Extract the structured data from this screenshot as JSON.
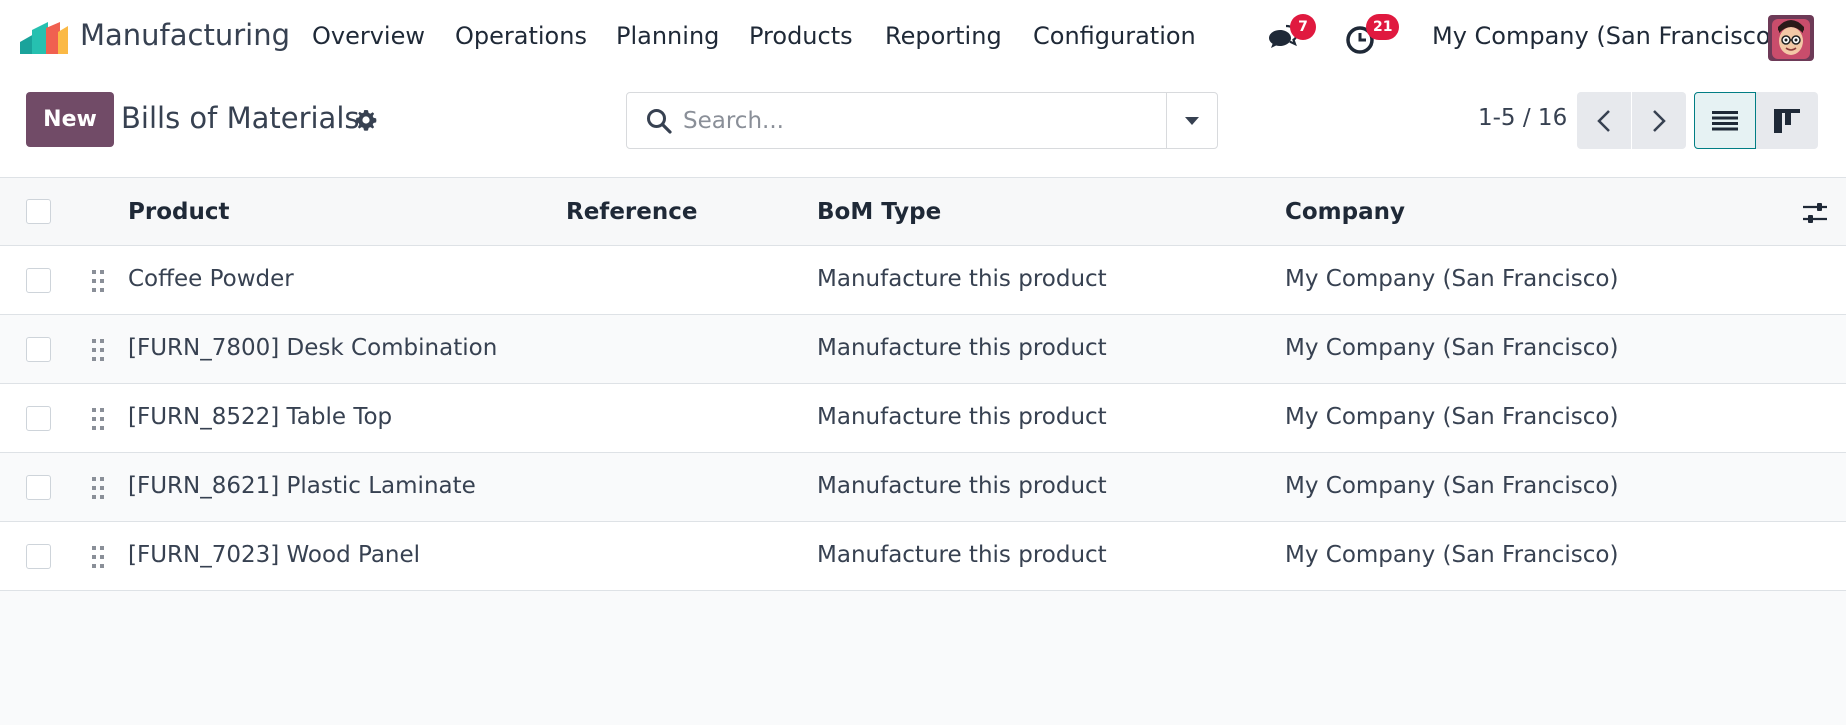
{
  "navbar": {
    "app_name": "Manufacturing",
    "menu": [
      "Overview",
      "Operations",
      "Planning",
      "Products",
      "Reporting",
      "Configuration"
    ],
    "messages_count": "7",
    "activities_count": "21",
    "company": "My Company (San Francisco)",
    "icons": {
      "logo": "manufacturing-app-logo",
      "messages": "chat-icon",
      "activities": "clock-icon",
      "avatar": "user-avatar"
    },
    "colors": {
      "badge": "#e0193f"
    }
  },
  "control_panel": {
    "new_label": "New",
    "title": "Bills of Materials",
    "settings_icon": "gear-icon",
    "search_placeholder": "Search...",
    "search_value": "",
    "pager": "1-5 / 16",
    "views": [
      "list-view-icon",
      "kanban-view-icon"
    ],
    "colors": {
      "primary": "#714b67",
      "active_view": "#017e84"
    }
  },
  "table": {
    "columns": [
      "Product",
      "Reference",
      "BoM Type",
      "Company"
    ],
    "rows": [
      {
        "product": "Coffee Powder",
        "reference": "",
        "bom_type": "Manufacture this product",
        "company": "My Company (San Francisco)"
      },
      {
        "product": "[FURN_7800] Desk Combination",
        "reference": "",
        "bom_type": "Manufacture this product",
        "company": "My Company (San Francisco)"
      },
      {
        "product": "[FURN_8522] Table Top",
        "reference": "",
        "bom_type": "Manufacture this product",
        "company": "My Company (San Francisco)"
      },
      {
        "product": "[FURN_8621] Plastic Laminate",
        "reference": "",
        "bom_type": "Manufacture this product",
        "company": "My Company (San Francisco)"
      },
      {
        "product": "[FURN_7023] Wood Panel",
        "reference": "",
        "bom_type": "Manufacture this product",
        "company": "My Company (San Francisco)"
      }
    ]
  }
}
